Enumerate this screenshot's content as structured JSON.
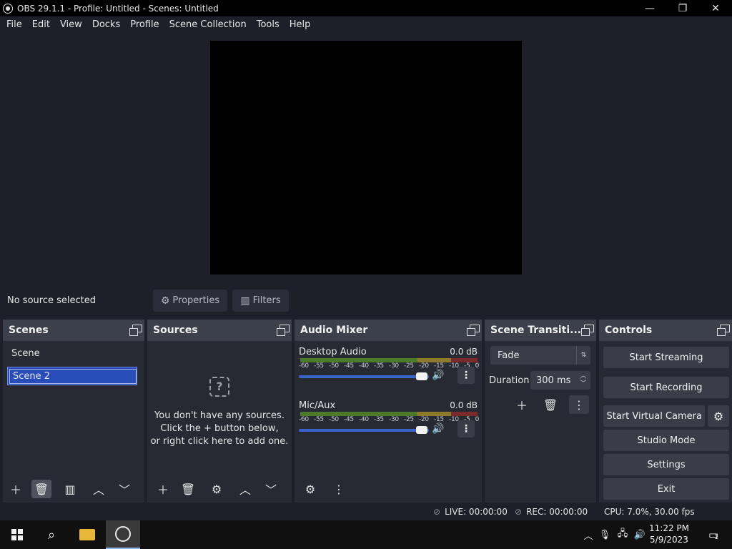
{
  "window": {
    "title": "OBS 29.1.1 - Profile: Untitled - Scenes: Untitled",
    "minimize": "—",
    "maximize": "❐",
    "close": "✕"
  },
  "menu": [
    "File",
    "Edit",
    "View",
    "Docks",
    "Profile",
    "Scene Collection",
    "Tools",
    "Help"
  ],
  "context": {
    "status": "No source selected",
    "properties_label": "Properties",
    "filters_label": "Filters"
  },
  "scenes": {
    "title": "Scenes",
    "items": [
      "Scene",
      "Scene 2"
    ],
    "selected_index": 1
  },
  "sources": {
    "title": "Sources",
    "empty_line1": "You don't have any sources.",
    "empty_line2": "Click the + button below,",
    "empty_line3": "or right click here to add one."
  },
  "audio_mixer": {
    "title": "Audio Mixer",
    "scale": [
      "-60",
      "-55",
      "-50",
      "-45",
      "-40",
      "-35",
      "-30",
      "-25",
      "-20",
      "-15",
      "-10",
      "-5",
      "0"
    ],
    "channels": [
      {
        "name": "Desktop Audio",
        "level": "0.0 dB",
        "volume_fraction": 1.0
      },
      {
        "name": "Mic/Aux",
        "level": "0.0 dB",
        "volume_fraction": 1.0
      }
    ]
  },
  "transitions": {
    "title": "Scene Transiti...",
    "selected": "Fade",
    "duration_label": "Duration",
    "duration_value": "300 ms"
  },
  "controls": {
    "title": "Controls",
    "start_streaming": "Start Streaming",
    "start_recording": "Start Recording",
    "start_virtual_camera": "Start Virtual Camera",
    "studio_mode": "Studio Mode",
    "settings": "Settings",
    "exit": "Exit"
  },
  "status": {
    "live": "LIVE: 00:00:00",
    "rec": "REC: 00:00:00",
    "cpu": "CPU: 7.0%, 30.00 fps"
  },
  "taskbar": {
    "time": "11:22 PM",
    "date": "5/9/2023",
    "notifications": "1"
  }
}
